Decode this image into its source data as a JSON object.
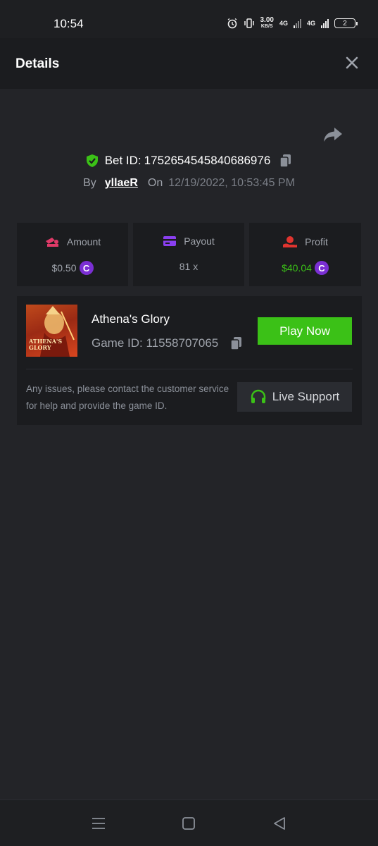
{
  "status_bar": {
    "time": "10:54",
    "net_speed_value": "3.00",
    "net_speed_unit": "KB/S",
    "network_1": "4G",
    "network_2": "4G",
    "battery": "2"
  },
  "header": {
    "title": "Details",
    "close_icon": "close-icon"
  },
  "bet": {
    "label": "Bet ID:",
    "id": "1752654545840686976",
    "by_label": "By",
    "user": "yllaeR",
    "on_label": "On",
    "datetime": "12/19/2022, 10:53:45 PM"
  },
  "stats": {
    "amount": {
      "label": "Amount",
      "value": "$0.50",
      "icon": "money-icon"
    },
    "payout": {
      "label": "Payout",
      "value": "81 x",
      "icon": "card-icon"
    },
    "profit": {
      "label": "Profit",
      "value": "$40.04",
      "icon": "coin-hand-icon"
    }
  },
  "game": {
    "name": "Athena's Glory",
    "id_label": "Game ID:",
    "id": "11558707065",
    "thumb_text": "ATHENA'S GLORY",
    "play_label": "Play Now"
  },
  "support": {
    "notice": "Any issues, please contact the customer service for help and provide the game ID.",
    "button_label": "Live Support"
  },
  "colors": {
    "accent_green": "#3bc117",
    "background": "#232428",
    "card": "#1b1c1f",
    "coin_purple": "#7b2fd4",
    "profit_green": "#3bc117"
  }
}
